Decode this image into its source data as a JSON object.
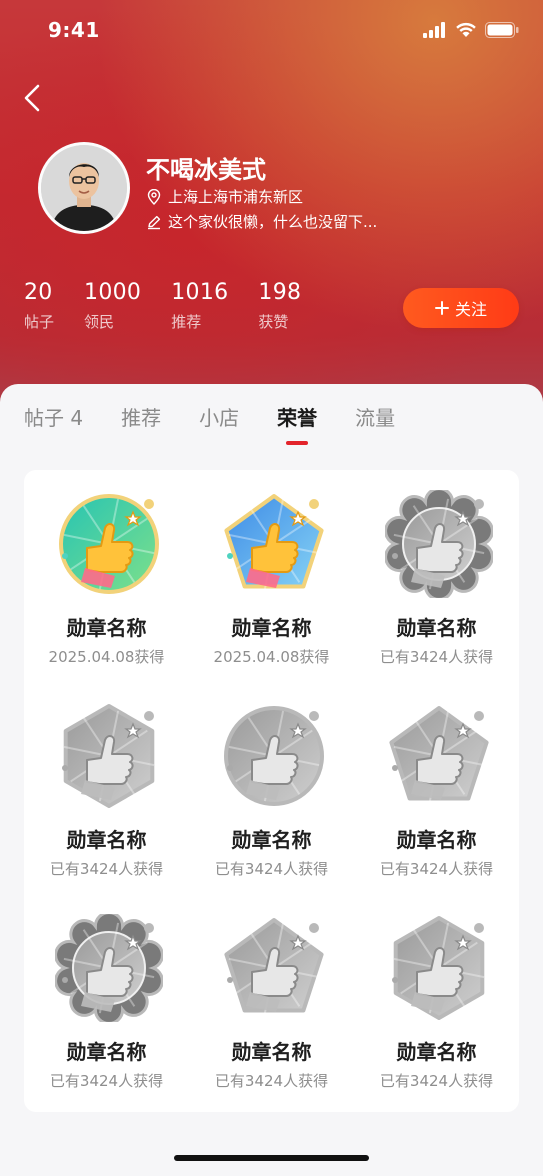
{
  "status": {
    "time": "9:41"
  },
  "profile": {
    "name": "不喝冰美式",
    "location": "上海上海市浦东新区",
    "bio": "这个家伙很懒，什么也没留下..."
  },
  "stats": [
    {
      "value": "20",
      "label": "帖子"
    },
    {
      "value": "1000",
      "label": "领民"
    },
    {
      "value": "1016",
      "label": "推荐"
    },
    {
      "value": "198",
      "label": "获赞"
    }
  ],
  "follow_button": {
    "label": "关注"
  },
  "tabs": [
    {
      "label": "帖子 4"
    },
    {
      "label": "推荐"
    },
    {
      "label": "小店"
    },
    {
      "label": "荣誉",
      "active": true
    },
    {
      "label": "流量"
    }
  ],
  "badges": [
    {
      "name": "勋章名称",
      "sub": "2025.04.08获得",
      "shape": "circle",
      "colored": true
    },
    {
      "name": "勋章名称",
      "sub": "2025.04.08获得",
      "shape": "pentagon",
      "colored": true
    },
    {
      "name": "勋章名称",
      "sub": "已有3424人获得",
      "shape": "scallop",
      "colored": false
    },
    {
      "name": "勋章名称",
      "sub": "已有3424人获得",
      "shape": "hexagon",
      "colored": false
    },
    {
      "name": "勋章名称",
      "sub": "已有3424人获得",
      "shape": "circle",
      "colored": false
    },
    {
      "name": "勋章名称",
      "sub": "已有3424人获得",
      "shape": "pentagon",
      "colored": false
    },
    {
      "name": "勋章名称",
      "sub": "已有3424人获得",
      "shape": "scallop",
      "colored": false
    },
    {
      "name": "勋章名称",
      "sub": "已有3424人获得",
      "shape": "pentagon",
      "colored": false
    },
    {
      "name": "勋章名称",
      "sub": "已有3424人获得",
      "shape": "hexagon",
      "colored": false
    }
  ],
  "colors": {
    "accent": "#e3242b",
    "follow": "#ff4a1a"
  }
}
